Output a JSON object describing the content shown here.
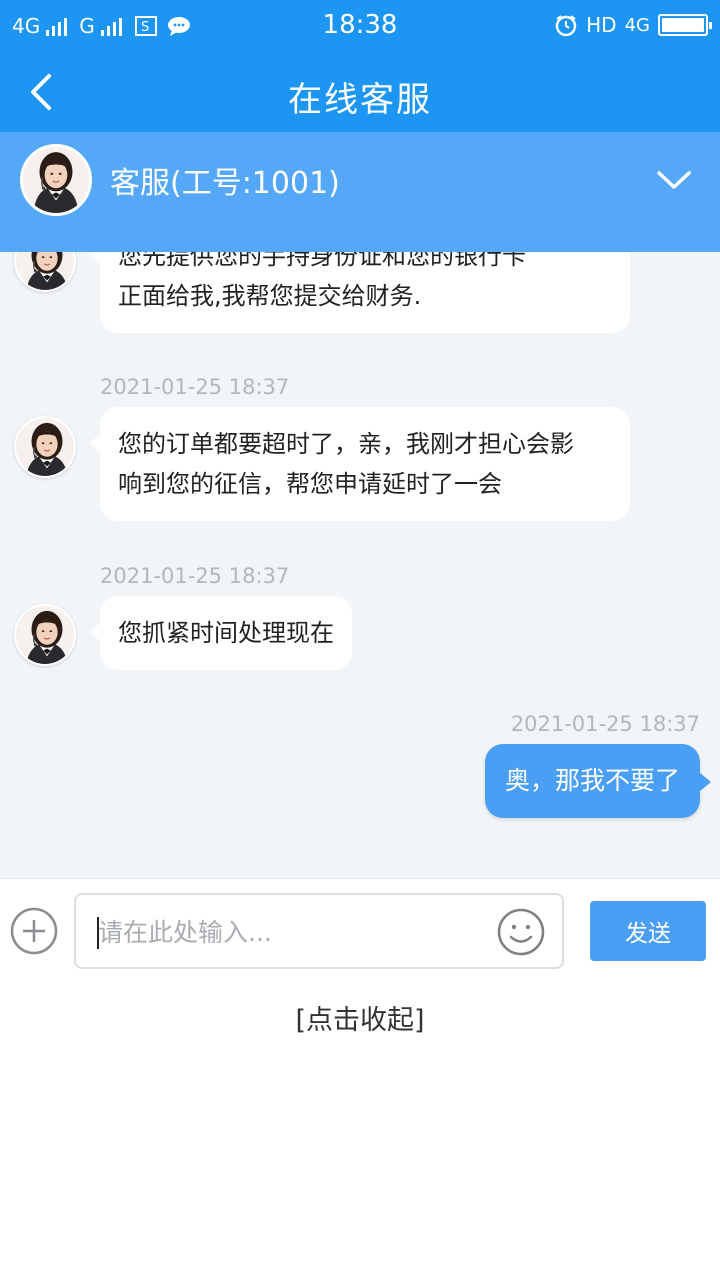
{
  "status_bar": {
    "network_1": "4G",
    "network_2": "G",
    "time": "18:38",
    "hd_label": "HD",
    "network_3": "4G"
  },
  "header": {
    "title": "在线客服"
  },
  "agent": {
    "name": "客服(工号:1001)"
  },
  "messages": [
    {
      "direction": "in",
      "lines": [
        "您先提供您的手持身份证和您的银行卡",
        "正面给我,我帮您提交给财务."
      ]
    },
    {
      "direction": "in",
      "timestamp": "2021-01-25 18:37",
      "lines": [
        "您的订单都要超时了，亲，我刚才担心会影",
        "响到您的征信，帮您申请延时了一会"
      ]
    },
    {
      "direction": "in",
      "timestamp": "2021-01-25 18:37",
      "lines": [
        "您抓紧时间处理现在"
      ]
    },
    {
      "direction": "out",
      "timestamp": "2021-01-25 18:37",
      "text": "奥，那我不要了"
    }
  ],
  "input": {
    "placeholder": "请在此处输入...",
    "value": "",
    "send_label": "发送"
  },
  "collapse_label": "[点击收起]",
  "colors": {
    "header_blue": "#1d96f3",
    "agent_bar": "#54a8f7",
    "outgoing_bubble": "#4a9ff5",
    "chat_background": "#f1f5f8"
  },
  "icons": {
    "back": "chevron-left-icon",
    "collapse": "chevron-down-icon",
    "plus": "plus-circle-icon",
    "emoji": "smiley-icon"
  }
}
